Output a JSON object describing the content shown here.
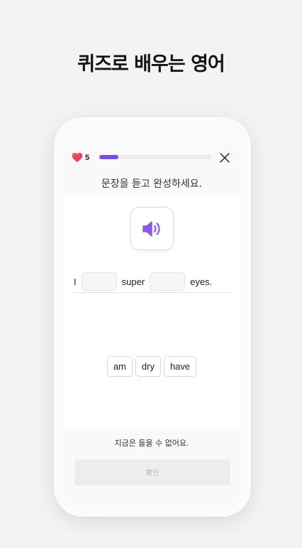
{
  "headline": "퀴즈로 배우는 영어",
  "quiz": {
    "hearts": "5",
    "progress_fraction": 0.17,
    "instruction": "문장을 듣고 완성하세요.",
    "sentence": {
      "word_1": "I",
      "word_2": "super",
      "word_3": "eyes."
    },
    "choices": [
      "am",
      "dry",
      "have"
    ],
    "cant_listen": "지금은 들을 수 없어요.",
    "confirm_label": "확인"
  },
  "icons": {
    "hearts": "heart-icon",
    "close": "close-icon",
    "audio": "speaker-icon"
  },
  "colors": {
    "accent": "#7b4ee0",
    "heart": "#e8455a"
  }
}
